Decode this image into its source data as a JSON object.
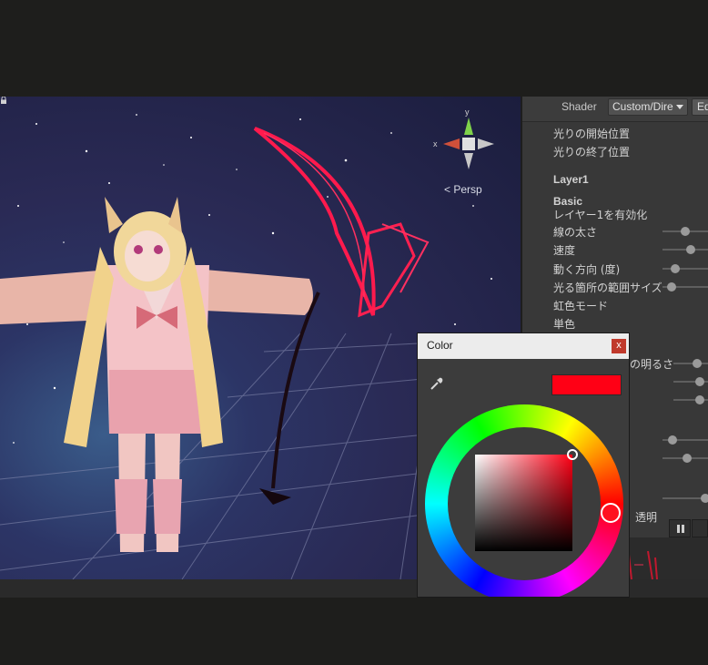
{
  "scene": {
    "projection_label": "< Persp",
    "gizmo_axes": {
      "y": "y",
      "x": "x"
    }
  },
  "inspector": {
    "shader_label": "Shader",
    "shader_value": "Custom/Dire",
    "edit_label": "Ed",
    "properties": [
      {
        "label": "光りの開始位置",
        "bold": false
      },
      {
        "label": "光りの終了位置",
        "bold": false
      },
      {
        "label": "Layer1",
        "bold": true
      },
      {
        "label": "Basic",
        "bold": true
      },
      {
        "label": "レイヤー1を有効化",
        "bold": false
      },
      {
        "label": "線の太さ",
        "bold": false
      },
      {
        "label": "速度",
        "bold": false
      },
      {
        "label": "動く方向 (度)",
        "bold": false
      },
      {
        "label": "光る箇所の範囲サイズ",
        "bold": false
      },
      {
        "label": "虹色モード",
        "bold": false
      },
      {
        "label": "単色",
        "bold": false
      },
      {
        "label": "の明るさ",
        "bold": false
      },
      {
        "label": "透明",
        "bold": false
      }
    ]
  },
  "color_picker": {
    "title": "Color",
    "close_label": "x",
    "current_color": "#ff0015"
  }
}
